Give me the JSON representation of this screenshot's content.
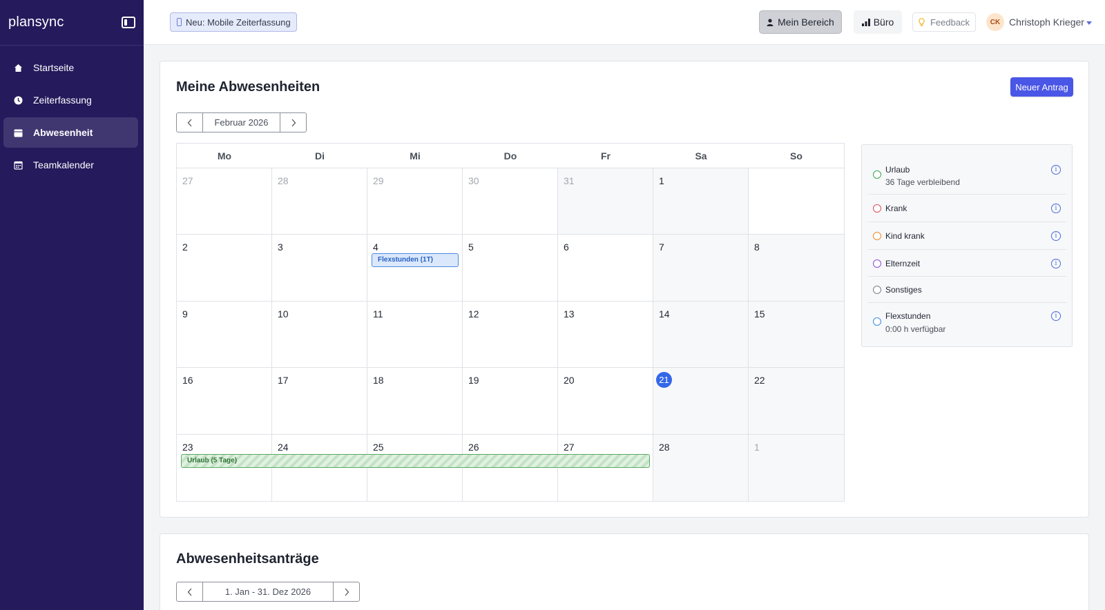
{
  "sidebar": {
    "brand": "plansync",
    "items": [
      {
        "label": "Startseite",
        "icon": "home-icon"
      },
      {
        "label": "Zeiterfassung",
        "icon": "clock-icon"
      },
      {
        "label": "Abwesenheit",
        "icon": "calendar-icon",
        "active": true
      },
      {
        "label": "Teamkalender",
        "icon": "calendar-grid-icon"
      }
    ]
  },
  "topbar": {
    "badge": "Neu: Mobile Zeiterfassung",
    "mein_bereich": "Mein Bereich",
    "buero": "Büro",
    "feedback": "Feedback",
    "avatar_initials": "CK",
    "user_name": "Christoph Krieger"
  },
  "absences": {
    "title": "Meine Abwesenheiten",
    "new_request": "Neuer Antrag",
    "month": "Februar 2026",
    "weekdays": [
      "Mo",
      "Di",
      "Mi",
      "Do",
      "Fr",
      "Sa",
      "So"
    ],
    "weeks": [
      [
        "27",
        "28",
        "29",
        "30",
        "31",
        "1",
        ""
      ],
      [
        "2",
        "3",
        "4",
        "5",
        "6",
        "7",
        "8"
      ],
      [
        "9",
        "10",
        "11",
        "12",
        "13",
        "14",
        "15"
      ],
      [
        "16",
        "17",
        "18",
        "19",
        "20",
        "21",
        "22"
      ],
      [
        "23",
        "24",
        "25",
        "26",
        "27",
        "28",
        "1"
      ]
    ],
    "today": "21",
    "events": {
      "flexstunden": "Flexstunden (1T)",
      "urlaub": "Urlaub (5 Tage)"
    }
  },
  "legend": {
    "urlaub": {
      "label": "Urlaub",
      "sub": "36 Tage verbleibend",
      "color": "#3aa34a"
    },
    "krank": {
      "label": "Krank",
      "color": "#e04b5a"
    },
    "kind_krank": {
      "label": "Kind krank",
      "color": "#f08a2a"
    },
    "elternzeit": {
      "label": "Elternzeit",
      "color": "#8a4ad8"
    },
    "sonstiges": {
      "label": "Sonstiges",
      "color": "#7a7f8a"
    },
    "flexstunden": {
      "label": "Flexstunden",
      "sub": "0:00 h verfügbar",
      "color": "#3a8ae2"
    },
    "info": "i"
  },
  "requests": {
    "title": "Abwesenheitsanträge",
    "range": "1. Jan - 31. Dez 2026"
  }
}
